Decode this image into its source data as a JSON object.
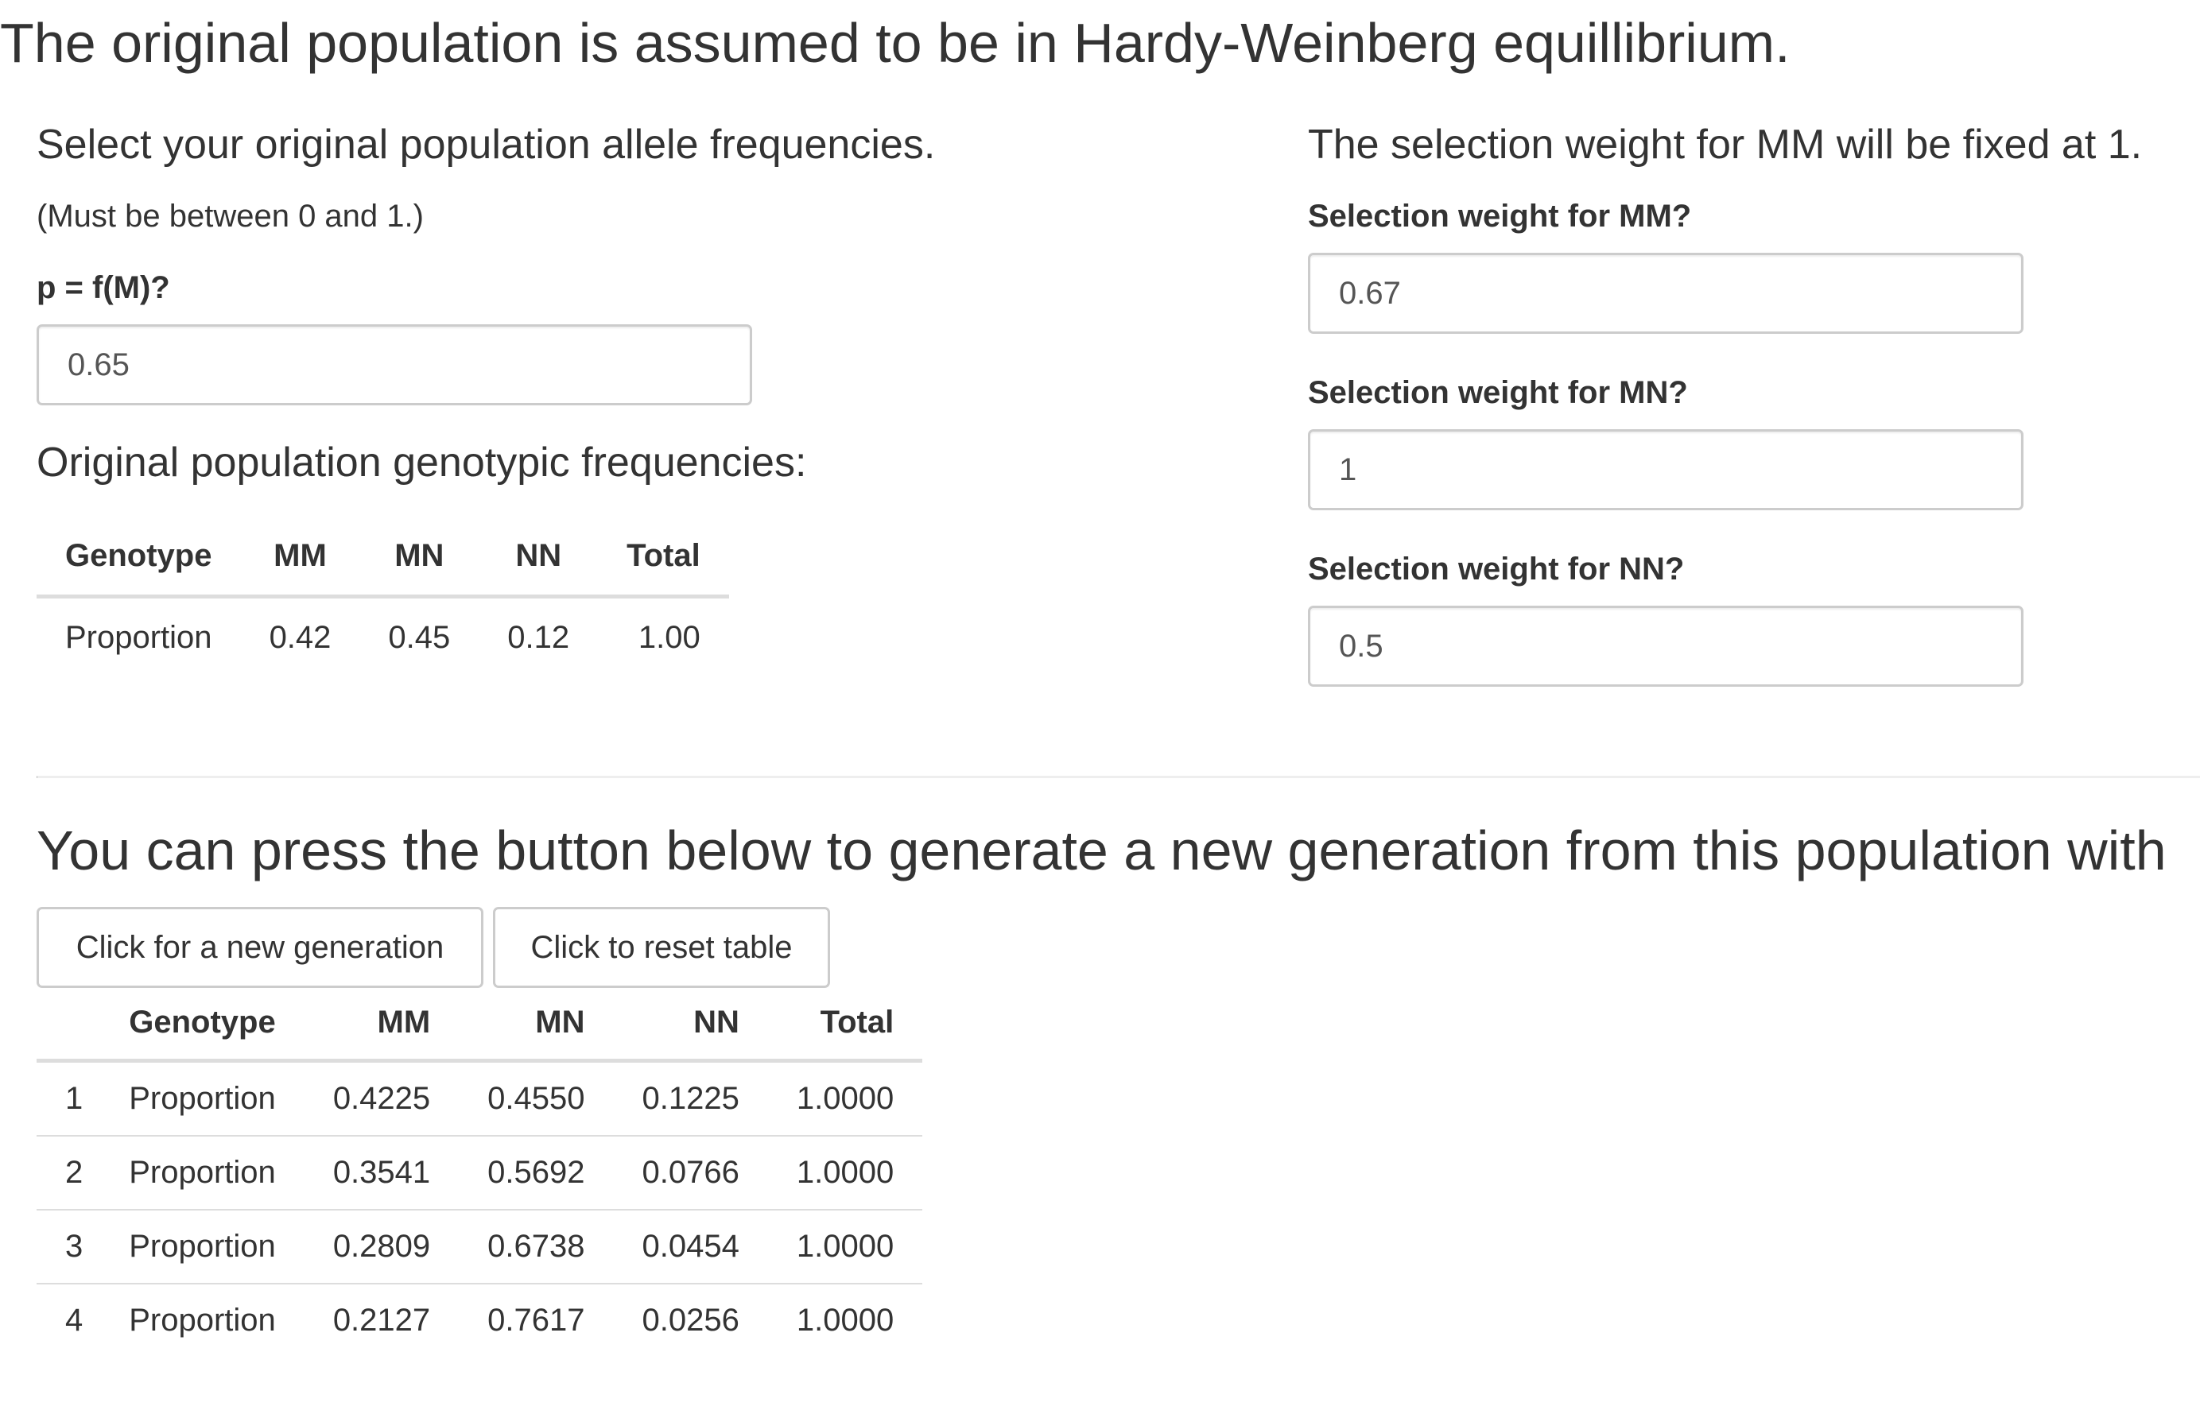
{
  "page_title": "The original population is assumed to be in Hardy-Weinberg equillibrium.",
  "allele": {
    "heading": "Select your original population allele frequencies.",
    "help": "(Must be between 0 and 1.)",
    "p_label": "p = f(M)?",
    "p_value": "0.65"
  },
  "original_genotypes": {
    "heading": "Original population genotypic frequencies:",
    "headers": [
      "Genotype",
      "MM",
      "MN",
      "NN",
      "Total"
    ],
    "row": [
      "Proportion",
      "0.42",
      "0.45",
      "0.12",
      "1.00"
    ]
  },
  "selection": {
    "heading": "The selection weight for MM will be fixed at 1.",
    "mm_label": "Selection weight for MM?",
    "mm_value": "0.67",
    "mn_label": "Selection weight for MN?",
    "mn_value": "1",
    "nn_label": "Selection weight for NN?",
    "nn_value": "0.5"
  },
  "generation": {
    "press_text": "You can press the button below to generate a new generation from this population with",
    "new_generation_button": "Click for a new generation",
    "reset_button": "Click to reset table",
    "headers": [
      "",
      "Genotype",
      "MM",
      "MN",
      "NN",
      "Total"
    ],
    "rows": [
      [
        "1",
        "Proportion",
        "0.4225",
        "0.4550",
        "0.1225",
        "1.0000"
      ],
      [
        "2",
        "Proportion",
        "0.3541",
        "0.5692",
        "0.0766",
        "1.0000"
      ],
      [
        "3",
        "Proportion",
        "0.2809",
        "0.6738",
        "0.0454",
        "1.0000"
      ],
      [
        "4",
        "Proportion",
        "0.2127",
        "0.7617",
        "0.0256",
        "1.0000"
      ]
    ]
  }
}
